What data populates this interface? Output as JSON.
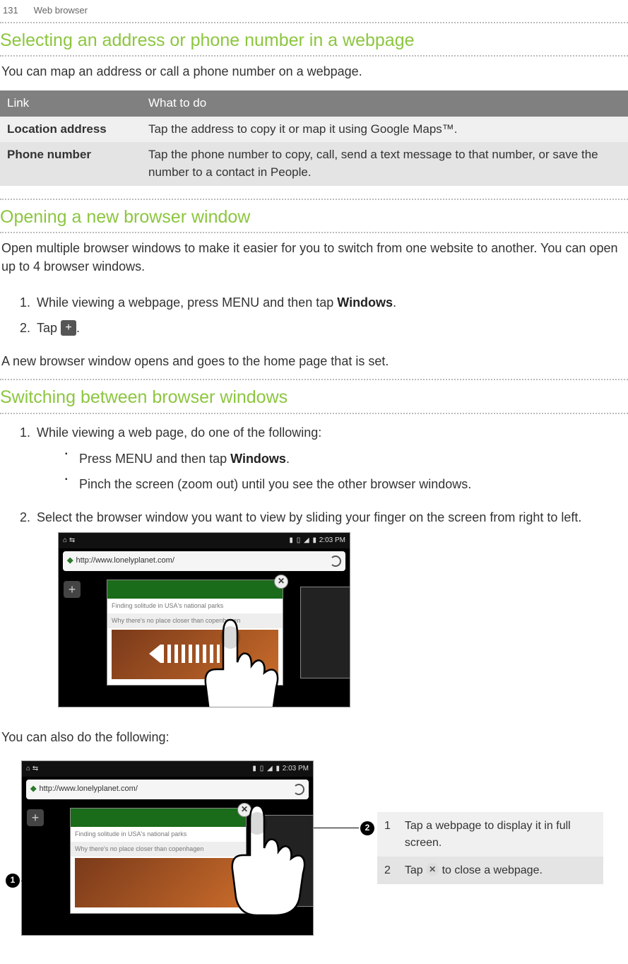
{
  "header": {
    "page_number": "131",
    "section": "Web browser"
  },
  "sec1": {
    "title": "Selecting an address or phone number in a webpage",
    "intro": "You can map an address or call a phone number on a webpage.",
    "table": {
      "headers": {
        "c1": "Link",
        "c2": "What to do"
      },
      "rows": [
        {
          "c1": "Location address",
          "c2": "Tap the address to copy it or map it using Google Maps™."
        },
        {
          "c1": "Phone number",
          "c2": "Tap the phone number to copy, call, send a text message to that number, or save the number to a contact in People."
        }
      ]
    }
  },
  "sec2": {
    "title": "Opening a new browser window",
    "intro": "Open multiple browser windows to make it easier for you to switch from one website to another. You can open up to 4 browser windows.",
    "steps": {
      "s1_a": "While viewing a webpage, press MENU and then tap ",
      "s1_b": "Windows",
      "s1_c": ".",
      "s2_a": "Tap ",
      "s2_c": "."
    },
    "after": "A new browser window opens and goes to the home page that is set."
  },
  "sec3": {
    "title": "Switching between browser windows",
    "s1": "While viewing a web page, do one of the following:",
    "sub1_a": "Press MENU and then tap ",
    "sub1_b": "Windows",
    "sub1_c": ".",
    "sub2": "Pinch the screen (zoom out) until you see the other browser windows.",
    "s2": "Select the browser window you want to view by sliding your finger on the screen from right to left.",
    "after": "You can also do the following:"
  },
  "screenshot": {
    "time": "2:03 PM",
    "url": "http://www.lonelyplanet.com/",
    "thumb_text1": "Finding solitude in USA's national parks",
    "thumb_text2": "Why there's no place closer than copenhagen"
  },
  "callouts": {
    "rows": [
      {
        "n": "1",
        "text_a": "Tap a webpage to display it in full screen."
      },
      {
        "n": "2",
        "text_a": "Tap ",
        "text_b": " to close a webpage."
      }
    ]
  },
  "icons": {
    "plus": "+",
    "close": "✕"
  }
}
